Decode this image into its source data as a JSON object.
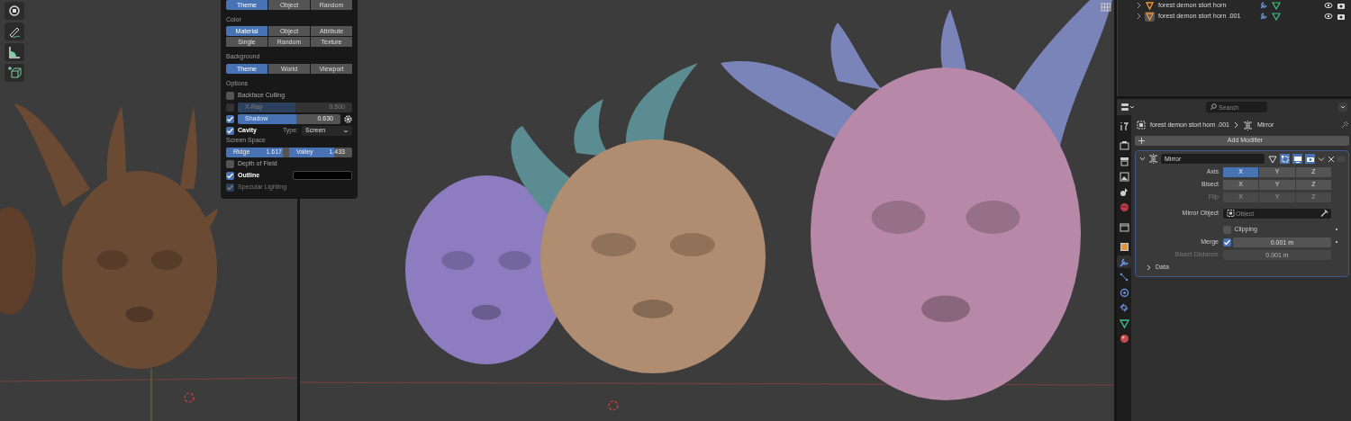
{
  "shading_popover": {
    "top_row": [
      {
        "label": "Theme",
        "selected": true
      },
      {
        "label": "Object",
        "selected": false
      },
      {
        "label": "Random",
        "selected": false
      }
    ],
    "color": {
      "label": "Color",
      "options": [
        {
          "label": "Material",
          "selected": true
        },
        {
          "label": "Object",
          "selected": false
        },
        {
          "label": "Attribute",
          "selected": false
        },
        {
          "label": "Single",
          "selected": false
        },
        {
          "label": "Random",
          "selected": false
        },
        {
          "label": "Texture",
          "selected": false
        }
      ]
    },
    "background": {
      "label": "Background",
      "options": [
        {
          "label": "Theme",
          "selected": true
        },
        {
          "label": "World",
          "selected": false
        },
        {
          "label": "Viewport",
          "selected": false
        }
      ]
    },
    "options": {
      "label": "Options",
      "items": [
        {
          "kind": "checkbox",
          "label": "Backface Culling",
          "checked": false,
          "disabled": false
        },
        {
          "kind": "slider",
          "label": "X-Ray",
          "checked": false,
          "disabled": true,
          "value": "0.500",
          "level": 0.5
        },
        {
          "kind": "slider_settings",
          "label": "Shadow",
          "checked": true,
          "disabled": false,
          "value": "0.630",
          "level": 0.57
        },
        {
          "kind": "cavity",
          "label": "Cavity",
          "checked": true,
          "disabled": false,
          "type_label": "Type:",
          "type_value": "Screen"
        }
      ]
    },
    "screen_space": {
      "label": "Screen Space",
      "sliders": [
        {
          "label": "Ridge",
          "value": "1.617",
          "level": 0.9
        },
        {
          "label": "Valley",
          "value": "1.433",
          "level": 0.72
        }
      ]
    },
    "more_options": [
      {
        "kind": "checkbox",
        "label": "Depth of Field",
        "checked": false,
        "disabled": false
      },
      {
        "kind": "color",
        "label": "Outline",
        "checked": true,
        "disabled": false,
        "color": "#000000"
      },
      {
        "kind": "checkbox",
        "label": "Specular Lighting",
        "checked": true,
        "disabled": true
      }
    ]
  },
  "outliner": {
    "rows": [
      {
        "name": "forest demon stort horn",
        "selected": false
      },
      {
        "name": "forest demon stort horn .001",
        "selected": true
      }
    ]
  },
  "properties": {
    "search": {
      "placeholder": "Search"
    },
    "tabs": [
      {
        "kind": "tool",
        "selected": false
      },
      {
        "kind": "render",
        "selected": false
      },
      {
        "kind": "output",
        "selected": false
      },
      {
        "kind": "view_layer",
        "selected": false
      },
      {
        "kind": "scene",
        "selected": false
      },
      {
        "kind": "world",
        "selected": false
      },
      {
        "kind": "collection",
        "selected": false
      },
      {
        "kind": "object",
        "selected": false
      },
      {
        "kind": "modifiers",
        "selected": true
      },
      {
        "kind": "particles",
        "selected": false
      },
      {
        "kind": "physics",
        "selected": false
      },
      {
        "kind": "constraints",
        "selected": false
      },
      {
        "kind": "data",
        "selected": false
      },
      {
        "kind": "material",
        "selected": false
      }
    ],
    "breadcrumb": {
      "object": "forest demon stort horn .001",
      "modifier": "Mirror"
    },
    "add_modifier": "Add Modifier",
    "modifier": {
      "name": "Mirror",
      "expanded": true,
      "toggles": [
        {
          "kind": "on_cage",
          "selected": false
        },
        {
          "kind": "edit_mode",
          "selected": true
        },
        {
          "kind": "viewport",
          "selected": true
        },
        {
          "kind": "render",
          "selected": true
        }
      ],
      "rows": [
        {
          "kind": "axes",
          "label": "Axis",
          "disabled": false,
          "options": [
            {
              "label": "X",
              "selected": true
            },
            {
              "label": "Y",
              "selected": false
            },
            {
              "label": "Z",
              "selected": false
            }
          ]
        },
        {
          "kind": "axes",
          "label": "Bisect",
          "disabled": false,
          "options": [
            {
              "label": "X",
              "selected": false
            },
            {
              "label": "Y",
              "selected": false
            },
            {
              "label": "Z",
              "selected": false
            }
          ]
        },
        {
          "kind": "axes",
          "label": "Flip",
          "disabled": true,
          "options": [
            {
              "label": "X",
              "selected": false
            },
            {
              "label": "Y",
              "selected": false
            },
            {
              "label": "Z",
              "selected": false
            }
          ]
        },
        {
          "kind": "object",
          "label": "Mirror Object",
          "placeholder": "Object"
        },
        {
          "kind": "checkbox",
          "label": "Clipping",
          "checked": false
        },
        {
          "kind": "checked_number",
          "label": "Merge",
          "checked": true,
          "value": "0.001 m"
        },
        {
          "kind": "number",
          "label": "Bisect Distance",
          "disabled": true,
          "value": "0.001 m"
        }
      ],
      "subpanels": [
        {
          "label": "Data",
          "expanded": false
        }
      ]
    }
  }
}
